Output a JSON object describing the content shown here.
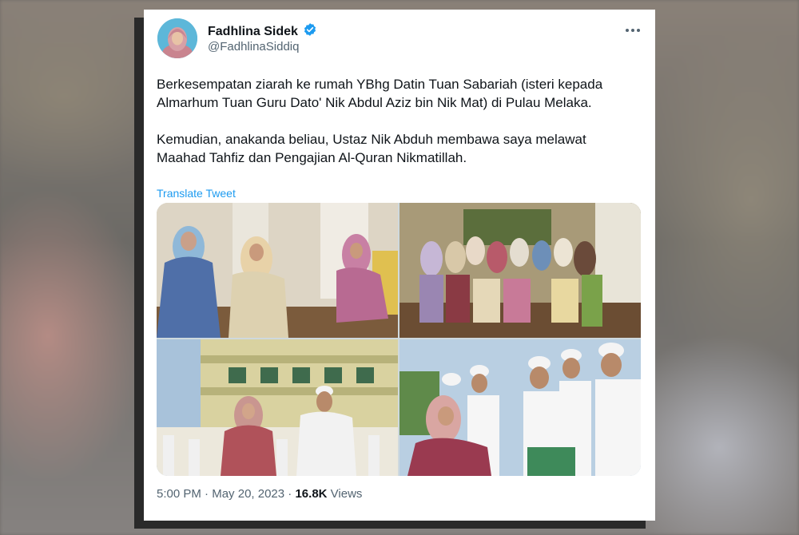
{
  "tweet": {
    "display_name": "Fadhlina Sidek",
    "handle": "@FadhlinaSiddiq",
    "more_icon": "more-horizontal-icon",
    "verified_icon": "verified-badge-icon",
    "text_p1": "Berkesempatan ziarah ke rumah YBhg Datin Tuan Sabariah (isteri kepada Almarhum Tuan Guru Dato' Nik Abdul Aziz bin Nik Mat) di Pulau Melaka.",
    "text_p2": "Kemudian, anakanda beliau, Ustaz Nik Abduh membawa saya melawat Maahad Tahfiz dan Pengajian Al-Quran Nikmatillah.",
    "translate_label": "Translate Tweet",
    "time": "5:00 PM",
    "date": "May 20, 2023",
    "views_count": "16.8K",
    "views_label": "Views",
    "separator": "·"
  },
  "colors": {
    "link": "#1d9bf0",
    "verified": "#1d9bf0",
    "secondary_text": "#536471",
    "primary_text": "#0f1419"
  }
}
